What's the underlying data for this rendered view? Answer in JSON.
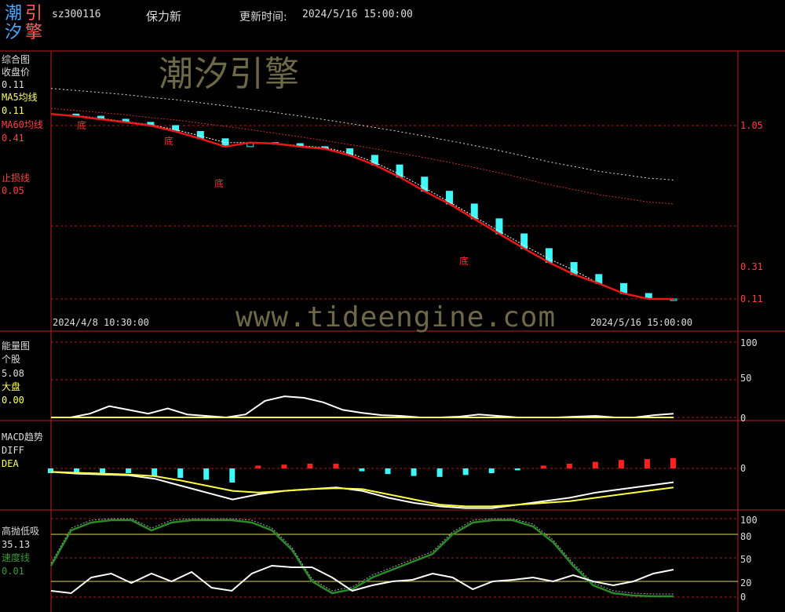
{
  "header": {
    "logo_chars": [
      "潮",
      "引",
      "汐",
      "擎"
    ],
    "code": "sz300116",
    "name": "保力新",
    "update_label": "更新时间:",
    "update_time": "2024/5/16 15:00:00"
  },
  "watermarks": {
    "brand": "潮汐引擎",
    "url": "www.tideengine.com"
  },
  "colors": {
    "up": "#ff2020",
    "down": "#3ff7f7",
    "ma5": "#ffff60",
    "ma60": "#ff3030",
    "grid": "#b01818",
    "frame": "#c02020"
  },
  "panels": {
    "main": {
      "title": "综合图",
      "close_label": "收盘价",
      "close_value": "0.11",
      "ma5_label": "MA5均线",
      "ma5_value": "0.11",
      "ma60_label": "MA60均线",
      "ma60_value": "0.41",
      "stop_label": "止损线",
      "stop_value": "0.05",
      "y_ticks": [
        "1.05",
        "0.31",
        "0.11"
      ],
      "start_time": "2024/4/8 10:30:00",
      "end_time": "2024/5/16 15:00:00",
      "bottom_marker": "底"
    },
    "energy": {
      "title": "能量图",
      "stock_label": "个股",
      "stock_value": "5.08",
      "market_label": "大盘",
      "market_value": "0.00",
      "y_ticks": [
        "100",
        "50",
        "0"
      ]
    },
    "macd": {
      "title": "MACD趋势",
      "diff_label": "DIFF",
      "dea_label": "DEA",
      "y_ticks": [
        "0"
      ]
    },
    "osc": {
      "title": "高抛低吸",
      "value": "35.13",
      "speed_label": "速度线",
      "speed_value": "0.01",
      "y_ticks": [
        "100",
        "80",
        "50",
        "20",
        "0"
      ]
    }
  },
  "chart_data": [
    {
      "type": "line",
      "title": "综合图",
      "x": [
        "2024/4/8 10:30:00",
        "2024/5/16 15:00:00"
      ],
      "series": [
        {
          "name": "收盘价",
          "values": [
            1.2,
            1.17,
            1.13,
            1.09,
            1.05,
            0.98,
            0.9,
            0.82,
            0.86,
            0.85,
            0.82,
            0.8,
            0.74,
            0.66,
            0.57,
            0.48,
            0.41,
            0.34,
            0.28,
            0.23,
            0.19,
            0.16,
            0.14,
            0.12,
            0.11,
            0.11
          ]
        },
        {
          "name": "MA5均线",
          "values": [
            1.2,
            1.18,
            1.14,
            1.1,
            1.06,
            1.0,
            0.93,
            0.86,
            0.86,
            0.85,
            0.83,
            0.81,
            0.76,
            0.68,
            0.59,
            0.5,
            0.42,
            0.35,
            0.29,
            0.24,
            0.2,
            0.17,
            0.14,
            0.12,
            0.11,
            0.11
          ]
        },
        {
          "name": "MA60均线",
          "values": [
            1.28,
            1.25,
            1.22,
            1.19,
            1.15,
            1.12,
            1.08,
            1.04,
            1.0,
            0.96,
            0.92,
            0.88,
            0.84,
            0.8,
            0.76,
            0.72,
            0.68,
            0.64,
            0.6,
            0.56,
            0.52,
            0.49,
            0.46,
            0.44,
            0.42,
            0.41
          ]
        }
      ],
      "y_ticks": [
        1.05,
        0.31,
        0.11
      ]
    },
    {
      "type": "line",
      "title": "能量图",
      "series": [
        {
          "name": "个股",
          "values": [
            0,
            0,
            5,
            15,
            10,
            5,
            12,
            4,
            2,
            0,
            4,
            22,
            28,
            26,
            20,
            10,
            6,
            3,
            2,
            0,
            0,
            1,
            4,
            2,
            0,
            0,
            0,
            1,
            2,
            0,
            0,
            3,
            5
          ]
        },
        {
          "name": "大盘",
          "values": [
            0,
            0,
            0,
            0,
            0,
            0,
            0,
            0,
            0,
            0,
            0,
            0,
            0,
            0,
            0,
            0,
            0,
            0,
            0,
            0,
            0,
            0,
            0,
            0,
            0,
            0,
            0,
            0,
            0,
            0,
            0,
            0,
            0
          ]
        }
      ],
      "y_ticks": [
        100,
        50,
        0
      ]
    },
    {
      "type": "bar",
      "title": "MACD趋势",
      "series": [
        {
          "name": "DIFF",
          "values": [
            -0.02,
            -0.03,
            -0.035,
            -0.04,
            -0.06,
            -0.1,
            -0.14,
            -0.18,
            -0.15,
            -0.13,
            -0.12,
            -0.11,
            -0.13,
            -0.17,
            -0.2,
            -0.22,
            -0.23,
            -0.23,
            -0.21,
            -0.19,
            -0.17,
            -0.14,
            -0.12,
            -0.1,
            -0.08
          ]
        },
        {
          "name": "DEA",
          "values": [
            -0.02,
            -0.025,
            -0.03,
            -0.035,
            -0.045,
            -0.07,
            -0.1,
            -0.13,
            -0.14,
            -0.13,
            -0.12,
            -0.115,
            -0.12,
            -0.15,
            -0.18,
            -0.21,
            -0.22,
            -0.22,
            -0.21,
            -0.2,
            -0.19,
            -0.17,
            -0.15,
            -0.13,
            -0.11
          ]
        }
      ],
      "histogram": [
        -0.5,
        -0.6,
        -0.7,
        -0.5,
        -0.8,
        -1.0,
        -1.2,
        -1.5,
        0.3,
        0.4,
        0.5,
        0.5,
        -0.3,
        -0.6,
        -0.8,
        -0.9,
        -0.7,
        -0.5,
        -0.2,
        0.3,
        0.5,
        0.7,
        0.9,
        1.0,
        1.1
      ],
      "y_ticks": [
        0
      ]
    },
    {
      "type": "line",
      "title": "高抛低吸",
      "series": [
        {
          "name": "高抛低吸",
          "values": [
            8,
            5,
            25,
            30,
            18,
            30,
            20,
            32,
            12,
            8,
            30,
            40,
            38,
            38,
            25,
            8,
            15,
            20,
            22,
            30,
            25,
            10,
            20,
            22,
            25,
            20,
            28,
            20,
            15,
            20,
            30,
            35
          ]
        },
        {
          "name": "速度线",
          "values": [
            40,
            85,
            95,
            98,
            98,
            85,
            95,
            98,
            98,
            98,
            95,
            85,
            60,
            20,
            5,
            10,
            25,
            35,
            45,
            55,
            80,
            95,
            98,
            98,
            90,
            70,
            40,
            15,
            5,
            2,
            1,
            1
          ]
        }
      ],
      "y_ticks": [
        100,
        80,
        50,
        20,
        0
      ]
    }
  ]
}
